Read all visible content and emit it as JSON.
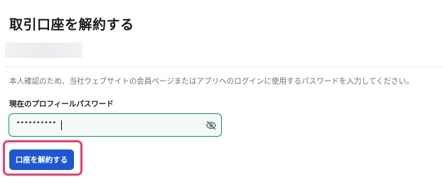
{
  "page": {
    "title": "取引口座を解約する"
  },
  "account": {
    "masked": true
  },
  "instruction_text": "本人確認のため、当社ウェブサイトの会員ページまたはアプリへのログインに使用するパスワードを入力してください。",
  "password_field": {
    "label": "現在のプロフィールパスワード",
    "value_masked": "••••••••••",
    "visibility_icon": "eye-off-icon"
  },
  "submit": {
    "label": "口座を解約する"
  },
  "colors": {
    "field_border": "#1d8f6b",
    "button_bg": "#1d57d6",
    "highlight": "#ea3d7a"
  }
}
